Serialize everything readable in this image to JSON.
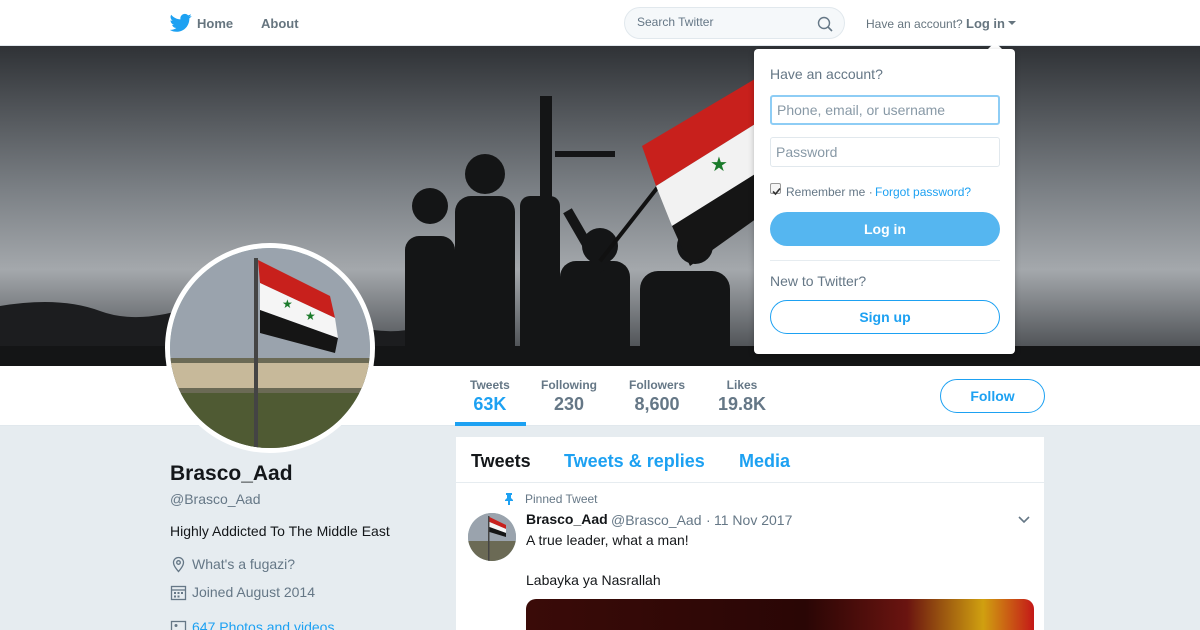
{
  "colors": {
    "accent": "#1da1f2",
    "background": "#e6ecf0",
    "muted": "#657786"
  },
  "nav": {
    "logo_icon": "twitter-bird-icon",
    "home_label": "Home",
    "about_label": "About",
    "search_placeholder": "Search Twitter",
    "search_icon": "search-icon",
    "have_account": "Have an account?",
    "login_label": "Log in"
  },
  "profile": {
    "name": "Brasco_Aad",
    "handle": "@Brasco_Aad",
    "bio": "Highly Addicted To The Middle East",
    "location": "What's a fugazi?",
    "joined": "Joined August 2014",
    "photos": "647 Photos and videos",
    "follow_label": "Follow"
  },
  "stats": [
    {
      "label": "Tweets",
      "value": "63K"
    },
    {
      "label": "Following",
      "value": "230"
    },
    {
      "label": "Followers",
      "value": "8,600"
    },
    {
      "label": "Likes",
      "value": "19.8K"
    }
  ],
  "timeline": {
    "tabs": [
      "Tweets",
      "Tweets & replies",
      "Media"
    ],
    "pinned_label": "Pinned Tweet",
    "tweet": {
      "name": "Brasco_Aad",
      "handle": "@Brasco_Aad",
      "separator": "·",
      "date": "11 Nov 2017",
      "line1": "A true leader, what a man!",
      "line2": "Labayka ya Nasrallah"
    }
  },
  "login_dropdown": {
    "title": "Have an account?",
    "username_placeholder": "Phone, email, or username",
    "password_placeholder": "Password",
    "remember_label": "Remember me ·",
    "forgot_label": "Forgot password?",
    "login_button": "Log in",
    "new_label": "New to Twitter?",
    "signup_button": "Sign up"
  }
}
